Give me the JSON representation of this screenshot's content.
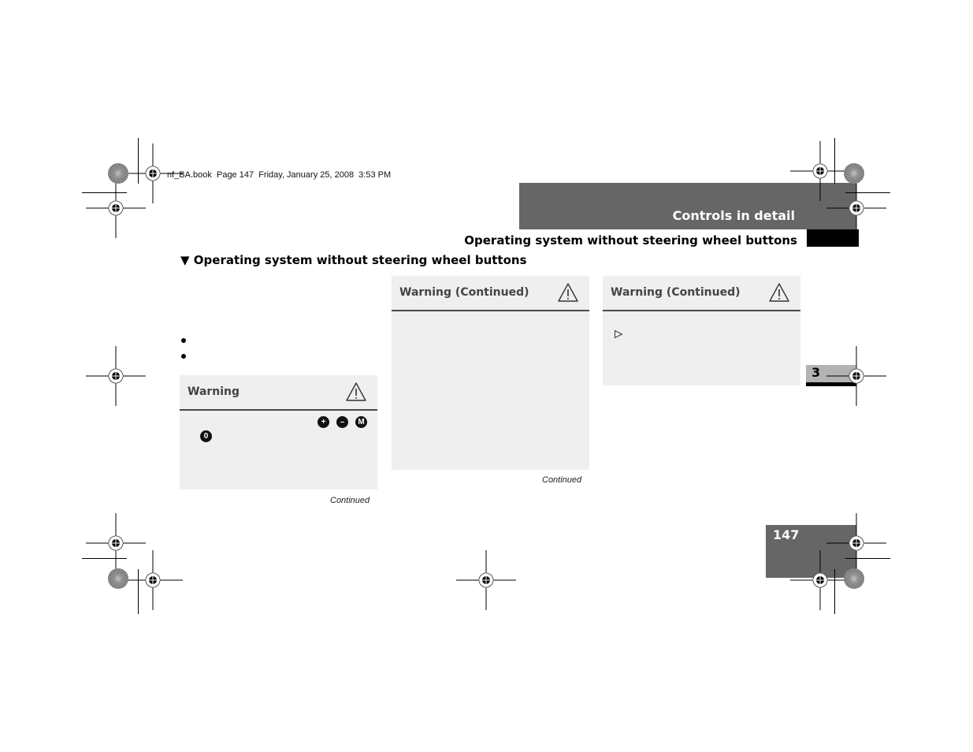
{
  "print_slug": "nf_BA.book  Page 147  Friday, January 25, 2008  3:53 PM",
  "header": {
    "chapter_title": "Controls in detail",
    "section_title": "Operating system without steering wheel buttons"
  },
  "content": {
    "heading_marker": "▼",
    "heading": "Operating system without steering wheel buttons",
    "bullets": [
      "",
      ""
    ]
  },
  "warning_boxes": [
    {
      "title": "Warning",
      "icon": "warning-triangle-icon",
      "keys_row1": [
        "+",
        "–",
        "M"
      ],
      "keys_row2": [
        "0"
      ],
      "footer": "Continued"
    },
    {
      "title": "Warning (Continued)",
      "icon": "warning-triangle-icon",
      "footer": "Continued"
    },
    {
      "title": "Warning (Continued)",
      "icon": "warning-triangle-icon",
      "step_marker": "▷"
    }
  ],
  "side_tab": {
    "chapter_number": "3"
  },
  "footer": {
    "page_number": "147"
  },
  "colors": {
    "dark_gray_bar": "#666666",
    "box_background": "#efefef",
    "box_rule": "#4a4a4a",
    "chapter_tab": "#b3b3b3"
  }
}
